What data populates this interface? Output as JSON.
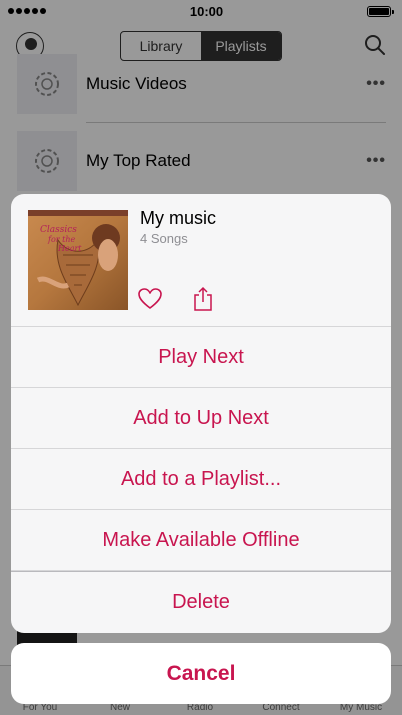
{
  "status_bar": {
    "time": "10:00"
  },
  "nav": {
    "segments": [
      {
        "label": "Library",
        "active": false
      },
      {
        "label": "Playlists",
        "active": true
      }
    ]
  },
  "background_list": [
    {
      "label": "Music Videos",
      "more": "•••"
    },
    {
      "label": "My Top Rated",
      "more": "•••"
    }
  ],
  "tab_bar": {
    "tabs": [
      "For You",
      "New",
      "Radio",
      "Connect",
      "My Music"
    ]
  },
  "sheet": {
    "title": "My music",
    "subtitle": "4 Songs",
    "icons": [
      "heart-icon",
      "share-icon"
    ],
    "actions": [
      "Play Next",
      "Add to Up Next",
      "Add to a Playlist...",
      "Make Available Offline",
      "Delete"
    ],
    "cancel_label": "Cancel"
  },
  "colors": {
    "accent": "#c8154f",
    "dim_overlay": "rgba(0,0,0,0.4)",
    "sheet_bg": "#f6f6f7"
  }
}
